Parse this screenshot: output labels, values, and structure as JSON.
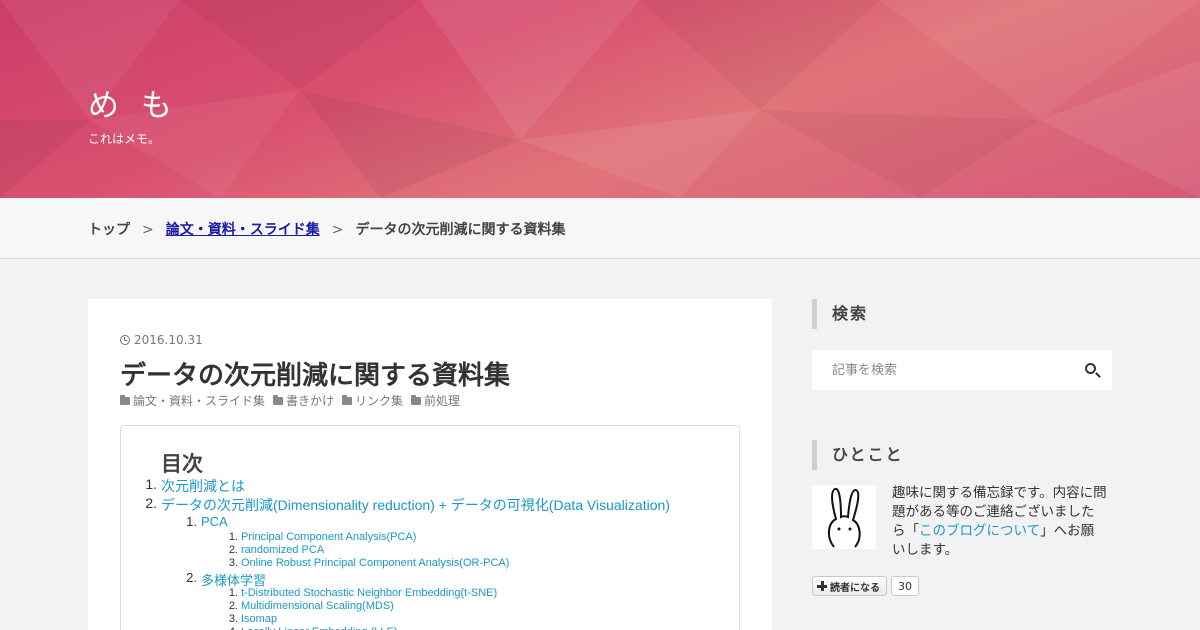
{
  "header": {
    "title": "め も",
    "description": "これはメモ。"
  },
  "breadcrumb": {
    "top": "トップ",
    "separator": ">",
    "category": "論文・資料・スライド集",
    "current": "データの次元削減に関する資料集"
  },
  "article": {
    "date": "2016.10.31",
    "title": "データの次元削減に関する資料集",
    "categories": [
      "論文・資料・スライド集",
      "書きかけ",
      "リンク集",
      "前処理"
    ],
    "toc": {
      "title": "目次",
      "items": [
        {
          "level": 1,
          "num": "1.",
          "label": "次元削減とは"
        },
        {
          "level": 1,
          "num": "2.",
          "label": "データの次元削減(Dimensionality reduction) + データの可視化(Data Visualization)"
        },
        {
          "level": 2,
          "num": "1.",
          "label": "PCA"
        },
        {
          "level": 3,
          "num": "1.",
          "label": "Principal Component Analysis(PCA)"
        },
        {
          "level": 3,
          "num": "2.",
          "label": "randomized PCA"
        },
        {
          "level": 3,
          "num": "3.",
          "label": "Online Robust Principal Component Analysis(OR-PCA)"
        },
        {
          "level": 2,
          "num": "2.",
          "label": "多様体学習"
        },
        {
          "level": 3,
          "num": "1.",
          "label": "t-Distributed Stochastic Neighbor Embedding(t-SNE)"
        },
        {
          "level": 3,
          "num": "2.",
          "label": "Multidimensional Scaling(MDS)"
        },
        {
          "level": 3,
          "num": "3.",
          "label": "Isomap"
        },
        {
          "level": 3,
          "num": "4.",
          "label": "Locally Linear Embedding (LLE)"
        }
      ]
    }
  },
  "sidebar": {
    "search": {
      "title": "検索",
      "placeholder": "記事を検索"
    },
    "profile": {
      "title": "ひとこと",
      "text_before": "趣味に関する備忘録です。内容に問題がある等のご連絡ございましたら「",
      "link": "このブログについて",
      "text_after": "」へお願いします。"
    },
    "subscribe": {
      "label": "読者になる",
      "count": "30"
    }
  },
  "colors": {
    "header_pink": "#d9506f",
    "link_blue": "#1a98c9",
    "breadcrumb_link": "#1a1aa6"
  }
}
